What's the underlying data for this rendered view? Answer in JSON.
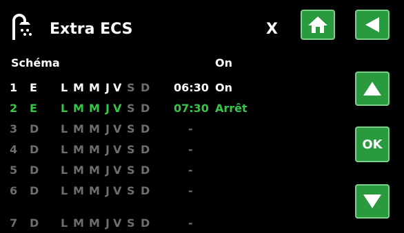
{
  "header": {
    "title": "Extra ECS",
    "close_label": "X",
    "icon": "shower-icon"
  },
  "buttons": {
    "home_icon": "home-icon",
    "back_icon": "back-arrow-icon",
    "up_icon": "up-arrow-icon",
    "ok_label": "OK",
    "down_icon": "down-arrow-icon",
    "accent_color": "#2a9a3e"
  },
  "table": {
    "schema_label": "Schéma",
    "on_label": "On",
    "rows": [
      {
        "num": "1",
        "mode": "E",
        "L": "L",
        "M1": "M",
        "M2": "M",
        "J": "J",
        "V": "V",
        "S": "S",
        "D": "D",
        "time": "06:30",
        "state": "On"
      },
      {
        "num": "2",
        "mode": "E",
        "L": "L",
        "M1": "M",
        "M2": "M",
        "J": "J",
        "V": "V",
        "S": "S",
        "D": "D",
        "time": "07:30",
        "state": "Arrêt"
      },
      {
        "num": "3",
        "mode": "D",
        "L": "L",
        "M1": "M",
        "M2": "M",
        "J": "J",
        "V": "V",
        "S": "S",
        "D": "D",
        "dash": "-"
      },
      {
        "num": "4",
        "mode": "D",
        "L": "L",
        "M1": "M",
        "M2": "M",
        "J": "J",
        "V": "V",
        "S": "S",
        "D": "D",
        "dash": "-"
      },
      {
        "num": "5",
        "mode": "D",
        "L": "L",
        "M1": "M",
        "M2": "M",
        "J": "J",
        "V": "V",
        "S": "S",
        "D": "D",
        "dash": "-"
      },
      {
        "num": "6",
        "mode": "D",
        "L": "L",
        "M1": "M",
        "M2": "M",
        "J": "J",
        "V": "V",
        "S": "S",
        "D": "D",
        "dash": "-"
      },
      {
        "num": "7",
        "mode": "D",
        "L": "L",
        "M1": "M",
        "M2": "M",
        "J": "J",
        "V": "V",
        "S": "S",
        "D": "D",
        "dash": "-"
      }
    ]
  }
}
